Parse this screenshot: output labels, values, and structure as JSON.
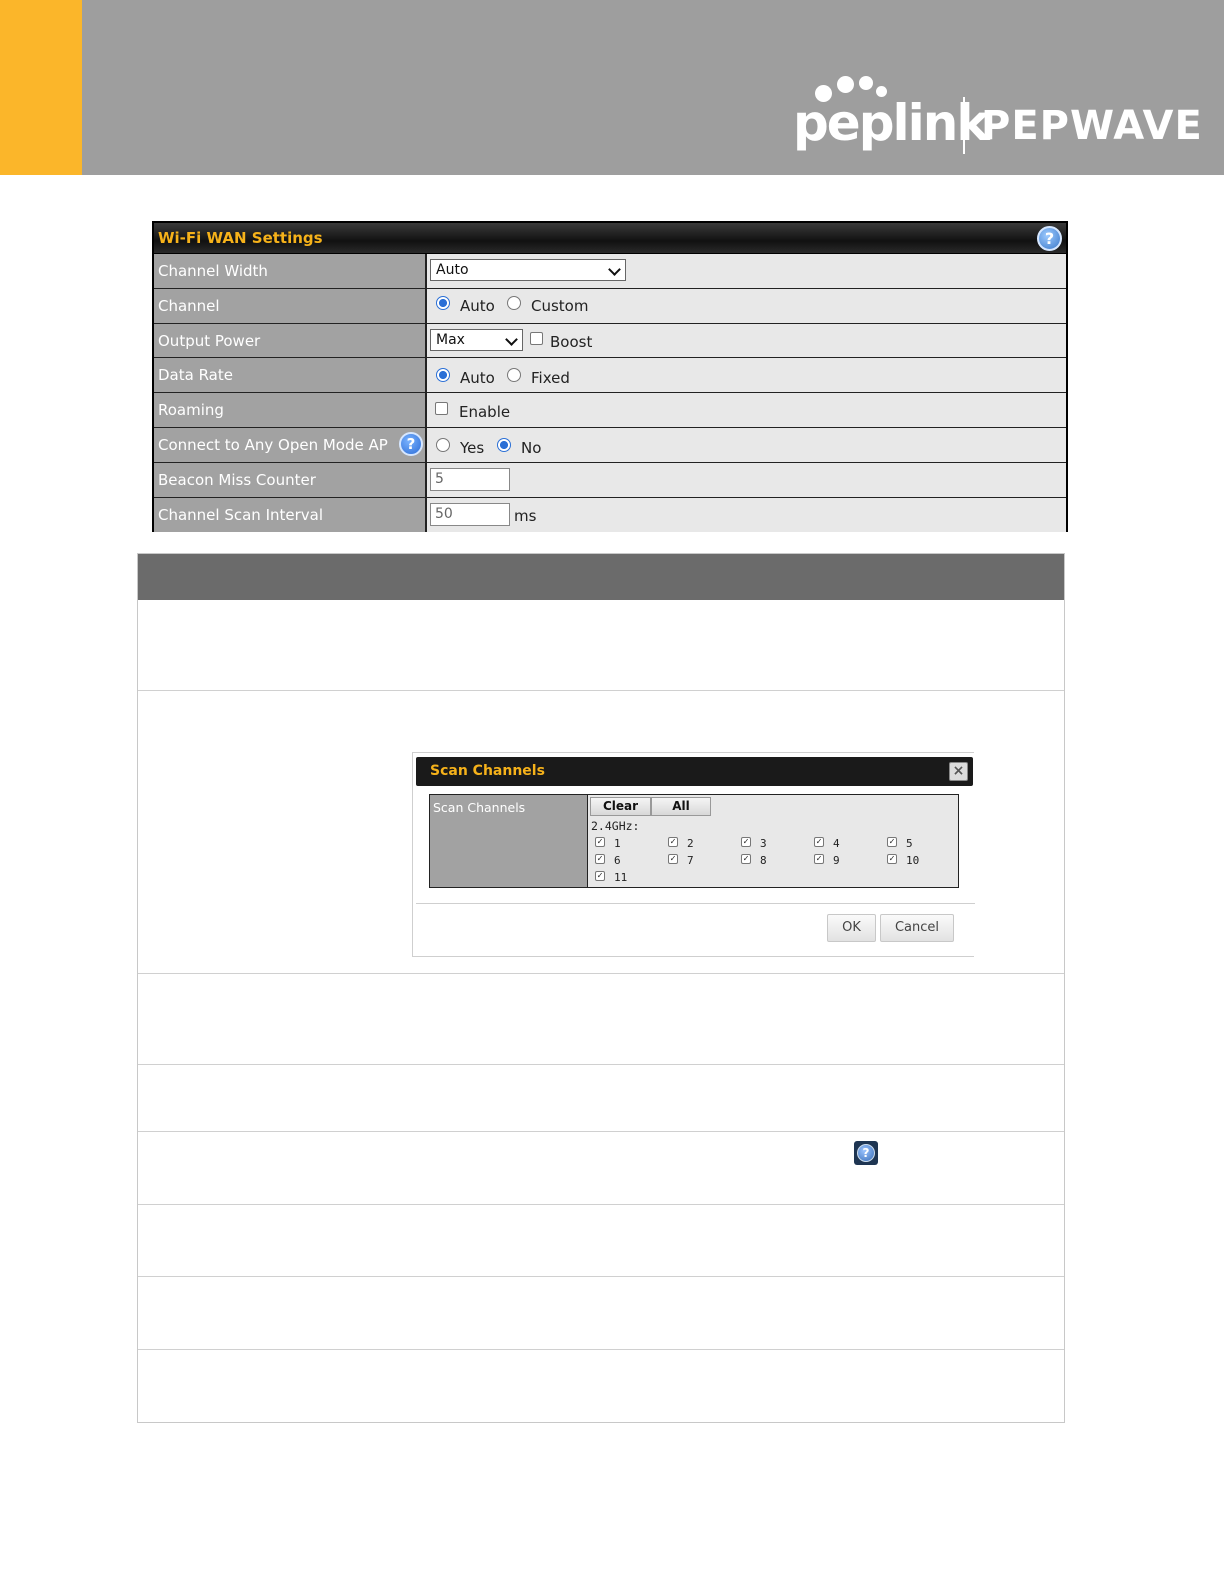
{
  "header": {
    "brand_primary": "peplink",
    "brand_secondary": "PEPWAVE",
    "colors": {
      "band": "#9e9e9e",
      "accent": "#fbb62a"
    }
  },
  "wifi_wan": {
    "title": "Wi-Fi WAN Settings",
    "help_icon": "?",
    "rows": {
      "channel_width": {
        "label": "Channel Width",
        "value": "Auto"
      },
      "channel": {
        "label": "Channel",
        "options": [
          "Auto",
          "Custom"
        ],
        "selected": "Auto"
      },
      "output_power": {
        "label": "Output Power",
        "value": "Max",
        "boost_label": "Boost"
      },
      "data_rate": {
        "label": "Data Rate",
        "options": [
          "Auto",
          "Fixed"
        ],
        "selected": "Auto"
      },
      "roaming": {
        "label": "Roaming",
        "enable_label": "Enable"
      },
      "open_mode": {
        "label": "Connect to Any Open Mode AP",
        "help_icon": "?",
        "options": [
          "Yes",
          "No"
        ],
        "selected": "No"
      },
      "beacon_miss": {
        "label": "Beacon Miss Counter",
        "value": "5"
      },
      "scan_interval": {
        "label": "Channel Scan Interval",
        "value": "50",
        "unit": "ms"
      }
    }
  },
  "scan_dialog": {
    "title": "Scan Channels",
    "close_icon": "×",
    "label": "Scan Channels",
    "clear_label": "Clear",
    "all_label": "All",
    "band_label": "2.4GHz:",
    "channels": [
      "1",
      "2",
      "3",
      "4",
      "5",
      "6",
      "7",
      "8",
      "9",
      "10",
      "11"
    ],
    "ok_label": "OK",
    "cancel_label": "Cancel"
  },
  "doc_help_icon": "?"
}
